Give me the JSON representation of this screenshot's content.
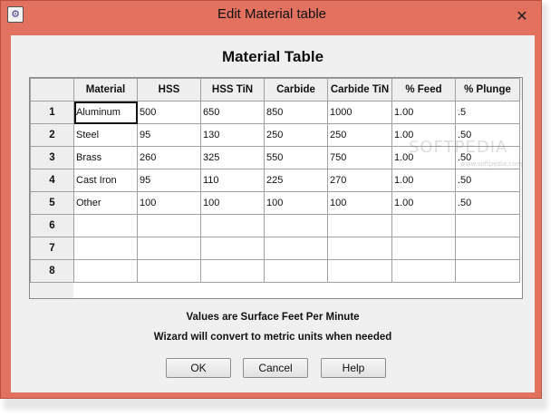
{
  "window": {
    "title": "Edit Material table",
    "close_symbol": "✕",
    "icon": "app-icon"
  },
  "heading": "Material Table",
  "table": {
    "columns": [
      "Material",
      "HSS",
      "HSS TiN",
      "Carbide",
      "Carbide TiN",
      "% Feed",
      "% Plunge"
    ],
    "rows": [
      {
        "num": "1",
        "cells": [
          "Aluminum",
          "500",
          "650",
          "850",
          "1000",
          "1.00",
          ".5"
        ]
      },
      {
        "num": "2",
        "cells": [
          "Steel",
          "95",
          "130",
          "250",
          "250",
          "1.00",
          ".50"
        ]
      },
      {
        "num": "3",
        "cells": [
          "Brass",
          "260",
          "325",
          "550",
          "750",
          "1.00",
          ".50"
        ]
      },
      {
        "num": "4",
        "cells": [
          "Cast Iron",
          " 95",
          "110",
          "225",
          "270",
          "1.00",
          ".50"
        ]
      },
      {
        "num": "5",
        "cells": [
          "Other",
          "100",
          "100",
          "100",
          "100",
          "1.00",
          ".50"
        ]
      },
      {
        "num": "6",
        "cells": [
          "",
          "",
          "",
          "",
          "",
          "",
          ""
        ]
      },
      {
        "num": "7",
        "cells": [
          "",
          "",
          "",
          "",
          "",
          "",
          ""
        ]
      },
      {
        "num": "8",
        "cells": [
          "",
          "",
          "",
          "",
          "",
          "",
          ""
        ]
      }
    ]
  },
  "watermark": {
    "main": "SOFTPEDIA",
    "sub": "www.softpedia.com"
  },
  "notes": {
    "line1": "Values are Surface Feet Per Minute",
    "line2": "Wizard will convert to metric units when needed"
  },
  "buttons": {
    "ok": "OK",
    "cancel": "Cancel",
    "help": "Help"
  }
}
